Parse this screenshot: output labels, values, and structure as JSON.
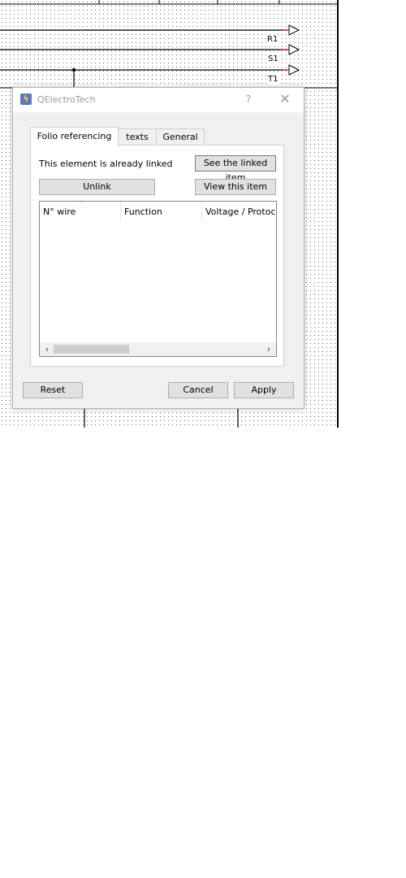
{
  "schematic": {
    "labels": [
      "R1",
      "S1",
      "T1"
    ]
  },
  "dialog": {
    "title": "QElectroTech",
    "help_glyph": "?",
    "close_glyph": "✕",
    "tabs": [
      {
        "label": "Folio referencing",
        "active": true
      },
      {
        "label": "texts",
        "active": false
      },
      {
        "label": "General",
        "active": false
      }
    ],
    "panel": {
      "linked_text": "This element is already linked",
      "see_linked_label": "See the linked item",
      "unlink_label": "Unlink",
      "view_item_label": "View this item",
      "table": {
        "columns": [
          "N° wire",
          "Function",
          "Voltage / Protocol"
        ],
        "rows": []
      }
    },
    "footer": {
      "reset_label": "Reset",
      "cancel_label": "Cancel",
      "apply_label": "Apply"
    }
  },
  "colors": {
    "dialog_bg": "#f0f0f0",
    "title_text": "#9a9a9a",
    "arrow_red": "#cc2222"
  },
  "icons": {
    "app": "qelectrotech-icon",
    "help": "help-icon",
    "close": "close-icon",
    "sort": "sort-down-icon",
    "scroll_left": "chevron-left-icon",
    "scroll_right": "chevron-right-icon"
  }
}
